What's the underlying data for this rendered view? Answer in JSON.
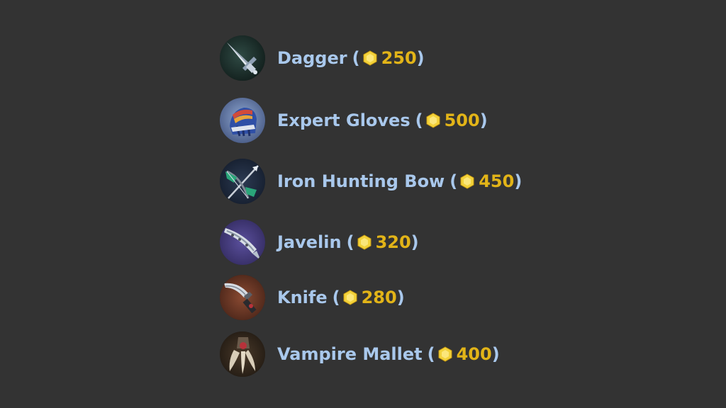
{
  "colors": {
    "background": "#333333",
    "name_text": "#a9c8ec",
    "price_text": "#e2b418",
    "gold_icon": "#f3d23a"
  },
  "currency_icon": "gold-coin-icon",
  "items": [
    {
      "name": "Dagger",
      "price": "250",
      "icon": "dagger-icon",
      "paren_open": "(",
      "paren_close": ")"
    },
    {
      "name": "Expert Gloves",
      "price": "500",
      "icon": "expert-gloves-icon",
      "paren_open": "(",
      "paren_close": ")"
    },
    {
      "name": "Iron Hunting Bow",
      "price": "450",
      "icon": "iron-hunting-bow-icon",
      "paren_open": "(",
      "paren_close": ")"
    },
    {
      "name": "Javelin",
      "price": "320",
      "icon": "javelin-icon",
      "paren_open": "(",
      "paren_close": ")"
    },
    {
      "name": "Knife",
      "price": "280",
      "icon": "knife-icon",
      "paren_open": "(",
      "paren_close": ")"
    },
    {
      "name": "Vampire Mallet",
      "price": "400",
      "icon": "vampire-mallet-icon",
      "paren_open": "(",
      "paren_close": ")"
    }
  ]
}
